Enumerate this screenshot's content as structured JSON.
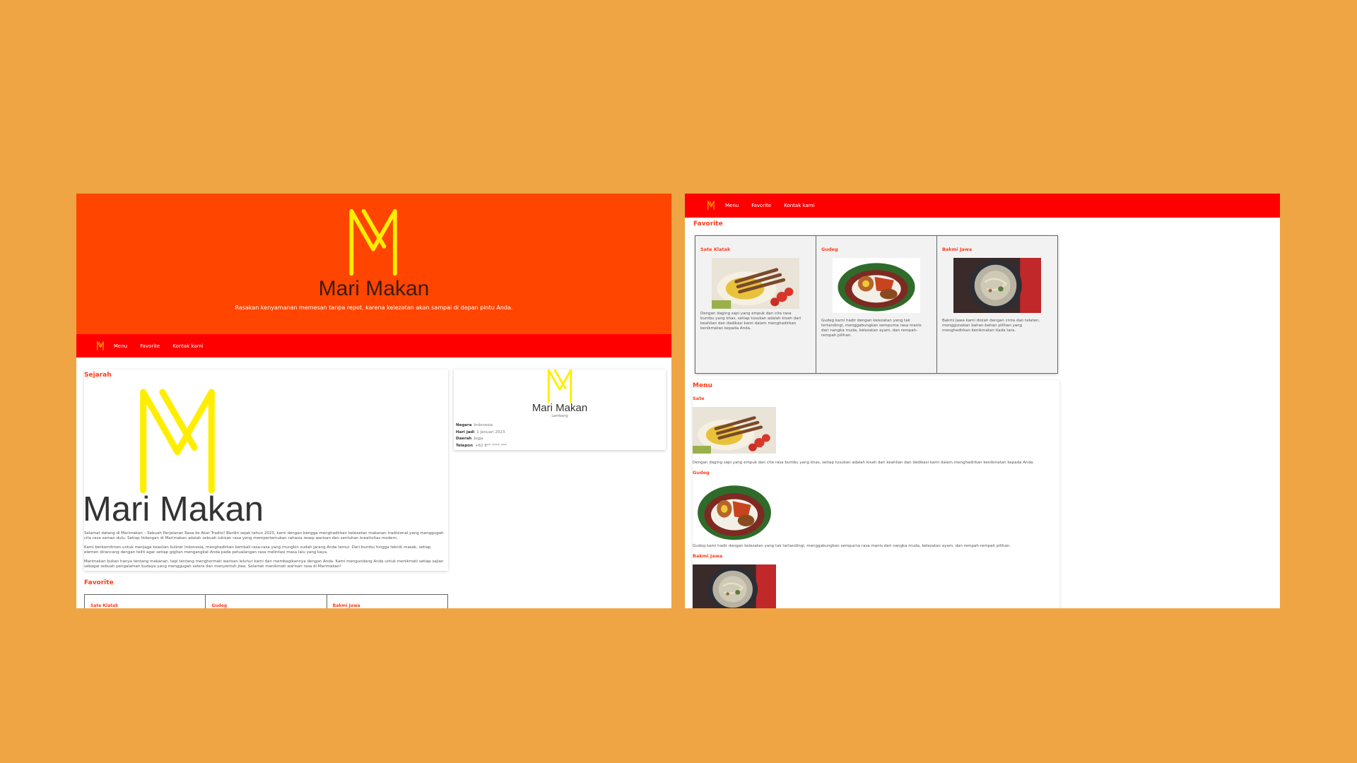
{
  "brand": {
    "name": "Mari Makan",
    "tagline": "Rasakan kenyamanan memesan tanpa repot, karena kelezatan akan sampai di depan pintu Anda.",
    "colors": {
      "hero": "#FF4500",
      "nav": "#FF0000",
      "accent": "#FF3A1A",
      "logo": "#FFFF00",
      "backdrop": "#EFA544"
    }
  },
  "nav": {
    "logo_icon": "mm-logo-icon",
    "links": [
      "Menu",
      "Favorite",
      "Kontak kami"
    ]
  },
  "sejarah": {
    "heading": "Sejarah",
    "title": "Mari Makan",
    "paragraphs": [
      "Selamat datang di Marimakan – Sebuah Perjalanan Rasa ke Akar Tradisi! Berdiri sejak tahun 2023, kami dengan bangga menghadirkan kelezatan makanan tradisional yang menggugah cita rasa zaman dulu. Setiap hidangan di Marimakan adalah sebuah lukisan rasa yang mempertemukan rahasia resep warisan dan sentuhan kreativitas modern.",
      "Kami berkomitmen untuk menjaga keaslian kuliner Indonesia, menghadirkan kembali rasa-rasa yang mungkin sudah jarang Anda temui. Dari bumbu hingga teknik masak, setiap elemen dirancang dengan teliti agar setiap gigitan mengangkat Anda pada petualangan rasa melintasi masa lalu yang kaya.",
      "Marimakan bukan hanya tentang makanan, tapi tentang menghormati warisan leluhur kami dan membagikannya dengan Anda. Kami mengundang Anda untuk menikmati setiap sajian sebagai sebuah pengalaman budaya yang menggugah selera dan menyentuh jiwa. Selamat menikmati warisan rasa di Marimakan!"
    ]
  },
  "info": {
    "title": "Mari Makan",
    "subtitle": "Lambang",
    "rows": [
      {
        "label": "Negara",
        "value": "Indonesia"
      },
      {
        "label": "Hari jadi",
        "value": "1 Januari 2023"
      },
      {
        "label": "Daerah",
        "value": "Jogja"
      },
      {
        "label": "Telepon",
        "value": "+62 8** **** ***"
      }
    ]
  },
  "favorite": {
    "heading": "Favorite",
    "items": [
      {
        "name": "Sate Klatak",
        "image": "sate-image",
        "desc": "Dengan daging sapi yang empuk dan cita rasa bumbu yang khas, setiap tusukan adalah kisah dari keahlian dan dedikasi kami dalam menghadirkan kenikmatan kepada Anda."
      },
      {
        "name": "Gudeg",
        "image": "gudeg-image",
        "desc": "Gudeg kami hadir dengan kelezatan yang tak tertandingi, menggabungkan sempurna rasa manis dari nangka muda, kelezatan ayam, dan rempah-rempah pilihan."
      },
      {
        "name": "Bakmi Jawa",
        "image": "bakmi-image",
        "desc": "Bakmi Jawa kami diolah dengan cinta dan telaten, menggunakan bahan-bahan pilihan yang menghadirkan kenikmatan tiada tara."
      }
    ]
  },
  "menu": {
    "heading": "Menu",
    "items": [
      {
        "name": "Sate",
        "image": "sate-image",
        "desc": "Dengan daging sapi yang empuk dan cita rasa bumbu yang khas, setiap tusukan adalah kisah dari keahlian dan dedikasi kami dalam menghadirkan kenikmatan kepada Anda."
      },
      {
        "name": "Gudeg",
        "image": "gudeg-image",
        "desc": "Gudeg kami hadir dengan kelezatan yang tak tertandingi, menggabungkan sempurna rasa manis dari nangka muda, kelezatan ayam, dan rempah-rempah pilihan."
      },
      {
        "name": "Bakmi Jawa",
        "image": "bakmi-image",
        "desc": ""
      }
    ]
  }
}
